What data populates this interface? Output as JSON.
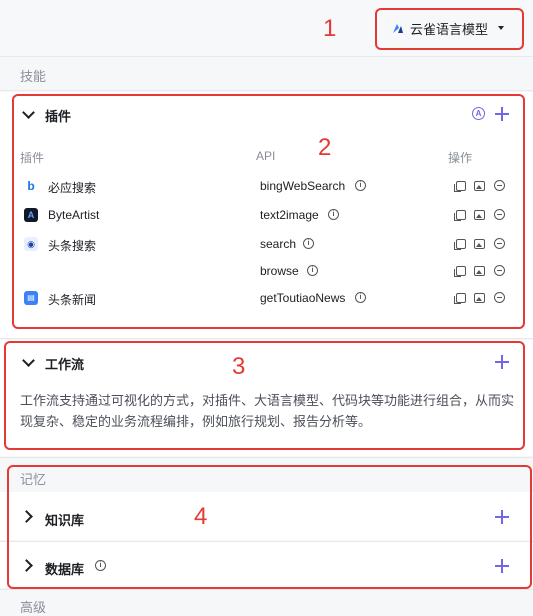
{
  "header": {
    "model_label": "云雀语言模型"
  },
  "annotations": [
    "1",
    "2",
    "3",
    "4"
  ],
  "skills": {
    "label": "技能",
    "plugins": {
      "title": "插件",
      "columns": [
        "插件",
        "API",
        "操作"
      ],
      "rows": [
        {
          "plugin": "必应搜索",
          "api": "bingWebSearch",
          "icon": "bing-icon"
        },
        {
          "plugin": "ByteArtist",
          "api": "text2image",
          "icon": "byteartist-icon"
        },
        {
          "plugin": "头条搜索",
          "api": "search",
          "icon": "toutiao-search-icon"
        },
        {
          "plugin": "",
          "api": "browse",
          "icon": ""
        },
        {
          "plugin": "头条新闻",
          "api": "getToutiaoNews",
          "icon": "toutiao-news-icon"
        }
      ]
    },
    "workflow": {
      "title": "工作流",
      "description": "工作流支持通过可视化的方式，对插件、大语言模型、代码块等功能进行组合，从而实现复杂、稳定的业务流程编排，例如旅行规划、报告分析等。"
    }
  },
  "memory": {
    "label": "记忆",
    "knowledge": {
      "title": "知识库"
    },
    "database": {
      "title": "数据库"
    }
  },
  "advanced": {
    "label": "高级"
  },
  "colors": {
    "accent": "#6f66e8",
    "annotation_red": "#e53935"
  }
}
